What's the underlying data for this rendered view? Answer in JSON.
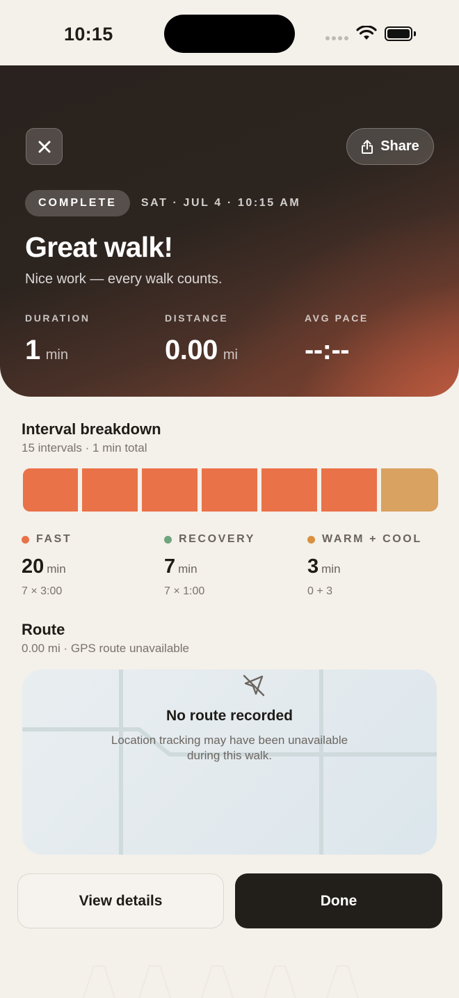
{
  "status_bar": {
    "time": "10:15",
    "icons": [
      "signal-dots-icon",
      "wifi-icon",
      "battery-icon"
    ]
  },
  "header": {
    "close_icon": "close-icon",
    "share_label": "Share",
    "share_icon": "share-icon"
  },
  "summary": {
    "badge": "COMPLETE",
    "date": "SAT · JUL 4 · 10:15 AM",
    "title": "Great walk!",
    "subtitle": "Nice work — every walk counts.",
    "stats": [
      {
        "label": "DURATION",
        "value": "1",
        "unit": "min"
      },
      {
        "label": "DISTANCE",
        "value": "0.00",
        "unit": "mi"
      },
      {
        "label": "AVG PACE",
        "value": "--:--",
        "unit": ""
      }
    ]
  },
  "intervals": {
    "title": "Interval breakdown",
    "subtitle": "15 intervals · 1 min total",
    "segments": [
      "fast",
      "fast",
      "fast",
      "fast",
      "fast",
      "fast",
      "warm-cool"
    ],
    "legend": [
      {
        "label": "FAST",
        "value": "20",
        "unit": "min",
        "detail": "7 × 3:00",
        "color": "#ea7248"
      },
      {
        "label": "RECOVERY",
        "value": "7",
        "unit": "min",
        "detail": "7 × 1:00",
        "color": "#6fa57e"
      },
      {
        "label": "WARM + COOL",
        "value": "3",
        "unit": "min",
        "detail": "0 + 3",
        "color": "#d9903f"
      }
    ]
  },
  "route": {
    "title": "Route",
    "subtitle": "0.00 mi · GPS route unavailable",
    "map_icon": "location-off-icon",
    "empty_title": "No route recorded",
    "empty_desc": "Location tracking may have been unavailable during this walk."
  },
  "actions": {
    "secondary": "View details",
    "primary": "Done"
  },
  "colors": {
    "fast": "#ea7248",
    "warm_cool": "#d9a260",
    "background": "#f4f0ea",
    "primary_button": "#221e1a"
  }
}
